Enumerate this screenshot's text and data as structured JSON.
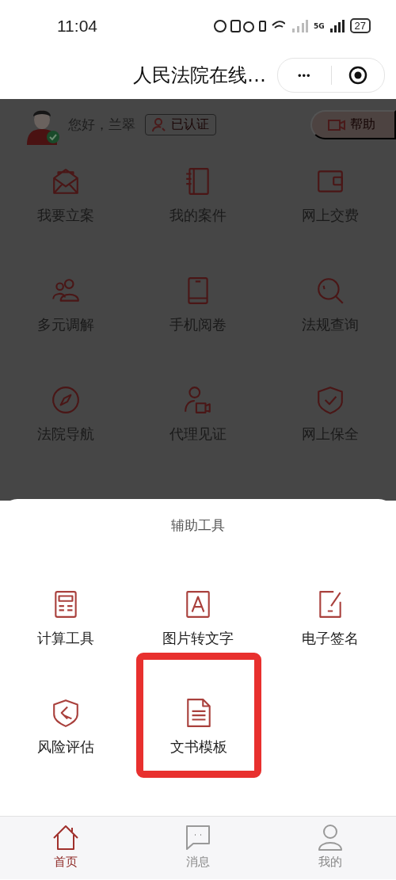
{
  "status_bar": {
    "time": "11:04",
    "battery": "27",
    "network": "5G"
  },
  "title_bar": {
    "title": "人民法院在线…",
    "more": "•••"
  },
  "user": {
    "greeting": "您好，兰翠",
    "verified_badge": "已认证",
    "help_button": "帮助"
  },
  "services": [
    {
      "label": "我要立案"
    },
    {
      "label": "我的案件"
    },
    {
      "label": "网上交费"
    },
    {
      "label": "多元调解"
    },
    {
      "label": "手机阅卷"
    },
    {
      "label": "法规查询"
    },
    {
      "label": "法院导航"
    },
    {
      "label": "代理见证"
    },
    {
      "label": "网上保全"
    }
  ],
  "sheet": {
    "title": "辅助工具",
    "tools": [
      {
        "label": "计算工具",
        "highlighted": false
      },
      {
        "label": "图片转文字",
        "highlighted": false
      },
      {
        "label": "电子签名",
        "highlighted": false
      },
      {
        "label": "风险评估",
        "highlighted": false
      },
      {
        "label": "文书模板",
        "highlighted": true
      }
    ]
  },
  "tab_bar": [
    {
      "label": "首页",
      "selected": true
    },
    {
      "label": "消息",
      "selected": false
    },
    {
      "label": "我的",
      "selected": false
    }
  ]
}
